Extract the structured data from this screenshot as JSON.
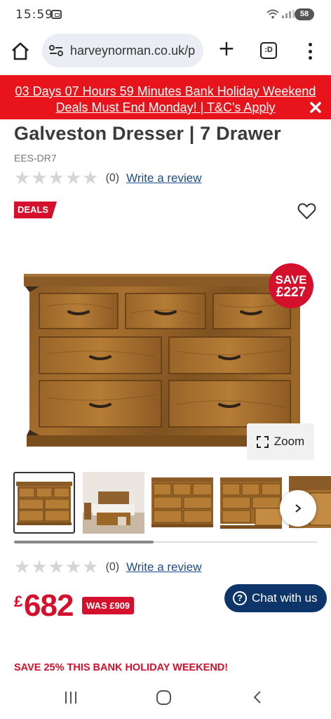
{
  "status_bar": {
    "time": "15:59",
    "battery": "58"
  },
  "browser": {
    "url": "harveynorman.co.uk/p",
    "tabs_label": ":D"
  },
  "promo_banner": {
    "line1": "03 Days 07 Hours 59 Minutes Bank Holiday Weekend",
    "line2": "Deals Must End Monday! | T&C's Apply",
    "bg_color": "#e8141c"
  },
  "product": {
    "title": "Galveston Dresser | 7 Drawer",
    "sku": "EES-DR7",
    "rating": {
      "stars": 0,
      "max_stars": 5,
      "count_label": "(0)",
      "write_review": "Write a review"
    },
    "deals_badge": "DEALS",
    "save_badge": {
      "line1": "SAVE",
      "line2": "£227"
    },
    "zoom_label": "Zoom",
    "thumbnails": [
      {
        "name": "dresser-front",
        "selected": true
      },
      {
        "name": "bedroom-scene",
        "selected": false
      },
      {
        "name": "dresser-angle",
        "selected": false
      },
      {
        "name": "dresser-open-drawer",
        "selected": false
      },
      {
        "name": "drawer-detail",
        "selected": false
      }
    ],
    "gallery_progress": 0.46,
    "price": {
      "currency": "£",
      "amount": "682",
      "was": "WAS £909"
    },
    "promo_note": "SAVE 25% THIS BANK HOLIDAY WEEKEND!"
  },
  "chat": {
    "label": "Chat with us",
    "icon": "?"
  },
  "colors": {
    "brand_red": "#d5102c",
    "chat_navy": "#0d3569",
    "link_blue": "#1c4d8c"
  }
}
